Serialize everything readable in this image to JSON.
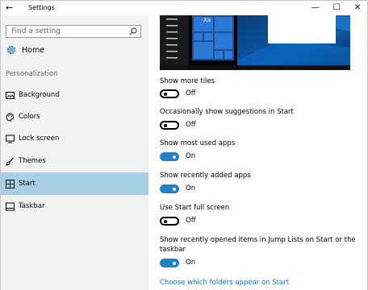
{
  "window": {
    "title": "Settings",
    "back_glyph": "←",
    "minimize_glyph": "—",
    "maximize_glyph": "☐",
    "close_glyph": "✕"
  },
  "sidebar": {
    "search": {
      "placeholder": "Find a setting",
      "icon": "search-icon"
    },
    "home": {
      "label": "Home",
      "icon": "gear-icon"
    },
    "section": "Personalization",
    "items": [
      {
        "label": "Background",
        "icon": "picture-icon",
        "selected": false
      },
      {
        "label": "Colors",
        "icon": "palette-icon",
        "selected": false
      },
      {
        "label": "Lock screen",
        "icon": "monitor-icon",
        "selected": false
      },
      {
        "label": "Themes",
        "icon": "brush-icon",
        "selected": false
      },
      {
        "label": "Start",
        "icon": "start-tiles-icon",
        "selected": true
      },
      {
        "label": "Taskbar",
        "icon": "taskbar-icon",
        "selected": false
      }
    ],
    "selected_color": "#a6cfe6"
  },
  "content": {
    "preview_tile_text": "Xa",
    "settings": [
      {
        "label": "Show more tiles",
        "state": "Off",
        "on": false
      },
      {
        "label": "Occasionally show suggestions in Start",
        "state": "Off",
        "on": false
      },
      {
        "label": "Show most used apps",
        "state": "On",
        "on": true
      },
      {
        "label": "Show recently added apps",
        "state": "On",
        "on": true
      },
      {
        "label": "Use Start full screen",
        "state": "Off",
        "on": false
      },
      {
        "label_line1": "Show recently opened items in Jump Lists on Start or the",
        "label_line2": "taskbar",
        "state": "On",
        "on": true
      }
    ],
    "link": "Choose which folders appear on Start",
    "accent": "#1f82c8",
    "link_color": "#1a73c9"
  }
}
